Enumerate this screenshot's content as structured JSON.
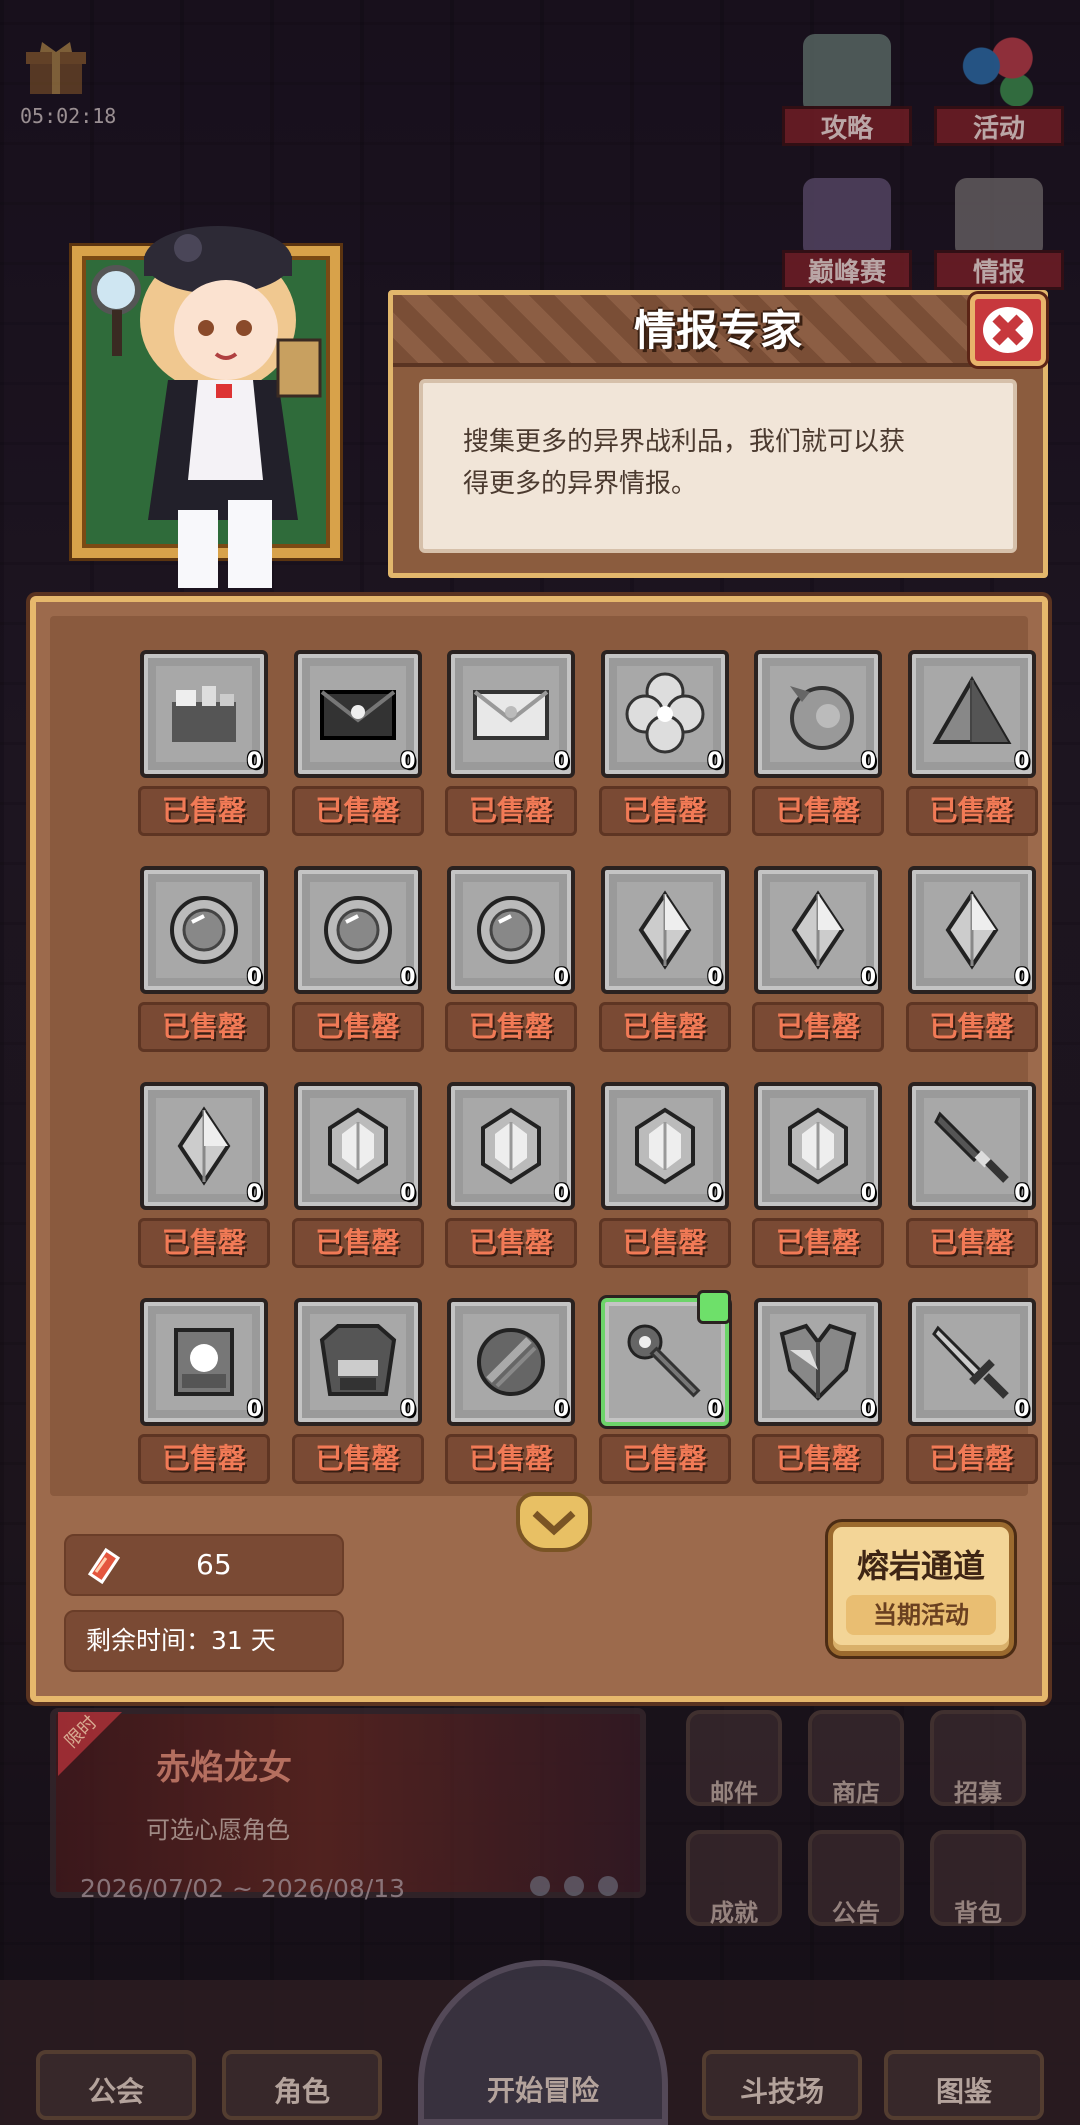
{
  "header": {
    "timer": "05:02:18",
    "buttons": [
      {
        "label": "攻略",
        "icon": "chat-bubble-icon"
      },
      {
        "label": "活动",
        "icon": "balloons-icon"
      },
      {
        "label": "巅峰赛",
        "icon": "swords-icon"
      },
      {
        "label": "情报",
        "icon": "first-aid-icon"
      }
    ]
  },
  "dialog": {
    "title": "情报专家",
    "body_line1": "搜集更多的异界战利品，我们就可以获",
    "body_line2": "得更多的异界情报。"
  },
  "inventory": {
    "items": [
      {
        "icon": "crate-icon",
        "count": "0",
        "status": "已售罄"
      },
      {
        "icon": "dark-envelope-icon",
        "count": "0",
        "status": "已售罄"
      },
      {
        "icon": "light-envelope-icon",
        "count": "0",
        "status": "已售罄"
      },
      {
        "icon": "flower-icon",
        "count": "0",
        "status": "已售罄"
      },
      {
        "icon": "orb-icon",
        "count": "0",
        "status": "已售罄"
      },
      {
        "icon": "pyramid-icon",
        "count": "0",
        "status": "已售罄"
      },
      {
        "icon": "lens-icon",
        "count": "0",
        "status": "已售罄"
      },
      {
        "icon": "lens-icon",
        "count": "0",
        "status": "已售罄"
      },
      {
        "icon": "lens-icon",
        "count": "0",
        "status": "已售罄"
      },
      {
        "icon": "crystal-icon",
        "count": "0",
        "status": "已售罄"
      },
      {
        "icon": "crystal-icon",
        "count": "0",
        "status": "已售罄"
      },
      {
        "icon": "crystal-icon",
        "count": "0",
        "status": "已售罄"
      },
      {
        "icon": "crystal-icon",
        "count": "0",
        "status": "已售罄"
      },
      {
        "icon": "gem-icon",
        "count": "0",
        "status": "已售罄"
      },
      {
        "icon": "gem-icon",
        "count": "0",
        "status": "已售罄"
      },
      {
        "icon": "gem-icon",
        "count": "0",
        "status": "已售罄"
      },
      {
        "icon": "gem-icon",
        "count": "0",
        "status": "已售罄"
      },
      {
        "icon": "dagger-icon",
        "count": "0",
        "status": "已售罄"
      },
      {
        "icon": "armor-icon",
        "count": "0",
        "status": "已售罄"
      },
      {
        "icon": "heavy-armor-icon",
        "count": "0",
        "status": "已售罄"
      },
      {
        "icon": "ball-icon",
        "count": "0",
        "status": "已售罄"
      },
      {
        "icon": "mace-icon",
        "count": "0",
        "status": "已售罄",
        "selected": true
      },
      {
        "icon": "shoulder-armor-icon",
        "count": "0",
        "status": "已售罄"
      },
      {
        "icon": "sword-icon",
        "count": "0",
        "status": "已售罄"
      }
    ]
  },
  "resources": {
    "value": "65",
    "time_label": "剩余时间：31 天"
  },
  "lava_button": {
    "title": "熔岩通道",
    "subtitle": "当期活动"
  },
  "event_banner": {
    "tag": "限时",
    "title": "赤焰龙女",
    "subtitle": "可选心愿角色",
    "date": "2026/07/02 ~ 2026/08/13"
  },
  "side_buttons": [
    "邮件",
    "商店",
    "招募",
    "成就",
    "公告",
    "背包"
  ],
  "nav": [
    "公会",
    "角色",
    "开始冒险",
    "斗技场",
    "图鉴"
  ],
  "colors": {
    "panel": "#9c6a4c",
    "gold_border": "#e6b86c",
    "sold_text": "#f17a56",
    "selected": "#6dd46a"
  }
}
